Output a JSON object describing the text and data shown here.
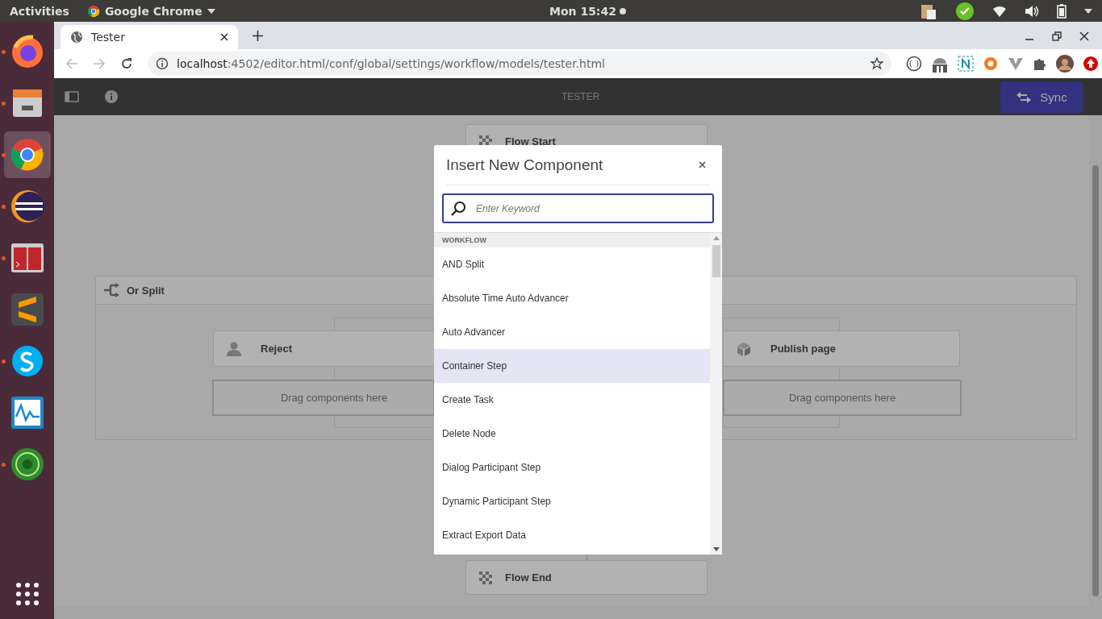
{
  "top_bar": {
    "activities": "Activities",
    "app_menu": "Google Chrome",
    "clock": "Mon 15:42"
  },
  "dock": [
    {
      "kind": "fox",
      "running": true,
      "selected": false
    },
    {
      "kind": "files",
      "running": true,
      "selected": false
    },
    {
      "kind": "chrome",
      "running": true,
      "selected": true
    },
    {
      "kind": "eclipse",
      "running": true,
      "selected": false
    },
    {
      "kind": "terminal",
      "running": true,
      "selected": false
    },
    {
      "kind": "sublime",
      "running": false,
      "selected": false
    },
    {
      "kind": "skype",
      "running": true,
      "selected": false
    },
    {
      "kind": "monitor",
      "running": false,
      "selected": false
    },
    {
      "kind": "green",
      "running": true,
      "selected": false
    }
  ],
  "browser": {
    "tab": "Tester",
    "url_host": "localhost",
    "url_path": ":4502/editor.html/conf/global/settings/workflow/models/tester.html"
  },
  "editor": {
    "title": "TESTER",
    "sync_button": "Sync"
  },
  "canvas": {
    "flow_start": "Flow Start",
    "or_split": "Or Split",
    "branches": [
      {
        "step": "Reject",
        "kind": "participant",
        "drop_hint": "Drag components here"
      },
      {
        "step": "Publish page",
        "kind": "process",
        "drop_hint": "Drag components here"
      }
    ],
    "flow_end": "Flow End"
  },
  "dialog": {
    "title": "Insert New Component",
    "search": {
      "placeholder": "Enter Keyword"
    },
    "group": "WORKFLOW",
    "items": [
      {
        "label": "AND Split",
        "selected": false
      },
      {
        "label": "Absolute Time Auto Advancer",
        "selected": false
      },
      {
        "label": "Auto Advancer",
        "selected": false
      },
      {
        "label": "Container Step",
        "selected": true
      },
      {
        "label": "Create Task",
        "selected": false
      },
      {
        "label": "Delete Node",
        "selected": false
      },
      {
        "label": "Dialog Participant Step",
        "selected": false
      },
      {
        "label": "Dynamic Participant Step",
        "selected": false
      },
      {
        "label": "Extract Export Data",
        "selected": false
      }
    ]
  }
}
